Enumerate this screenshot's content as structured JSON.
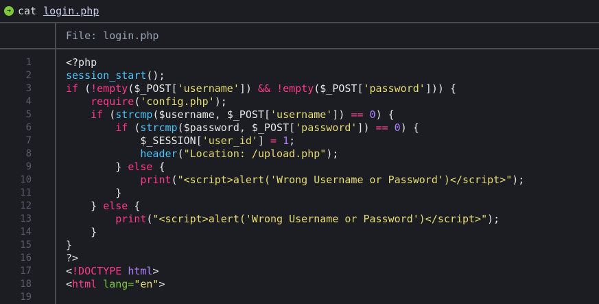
{
  "prompt": {
    "command": "cat",
    "file": "login.php"
  },
  "header": {
    "label": "File: login.php"
  },
  "code": {
    "lines": [
      "1",
      "2",
      "3",
      "4",
      "5",
      "6",
      "7",
      "8",
      "9",
      "10",
      "11",
      "12",
      "13",
      "14",
      "15",
      "16",
      "17",
      "18",
      "19"
    ]
  }
}
